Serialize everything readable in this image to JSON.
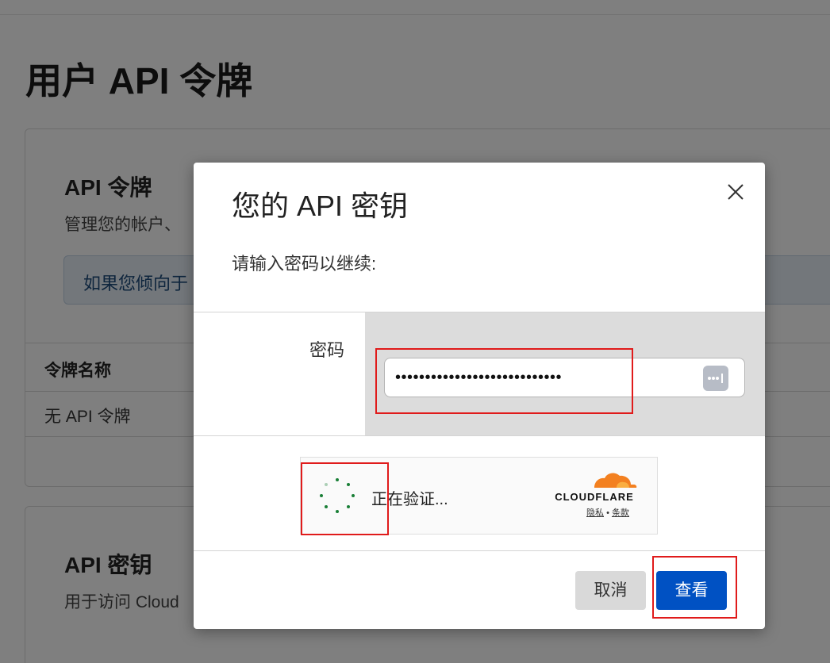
{
  "page": {
    "title": "用户 API 令牌"
  },
  "tokens_card": {
    "heading": "API 令牌",
    "description": "管理您的帐户、",
    "alert_text": "如果您倾向于",
    "table_header": "令牌名称",
    "empty_row": "无 API 令牌"
  },
  "keys_card": {
    "heading": "API 密钥",
    "description": "用于访问 Cloud"
  },
  "modal": {
    "title": "您的 API 密钥",
    "prompt": "请输入密码以继续:",
    "password_label": "密码",
    "password_value": "••••••••••••••••••••••••••••",
    "captcha": {
      "status": "正在验证...",
      "brand": "CLOUDFLARE",
      "privacy_link": "隐私",
      "separator": "•",
      "terms_link": "条款"
    },
    "cancel_label": "取消",
    "view_label": "查看"
  },
  "icons": {
    "close": "close-icon",
    "password_manager": "password-manager-icon",
    "spinner": "loading-spinner-icon",
    "cloudflare_logo": "cloudflare-logo"
  },
  "colors": {
    "primary_button": "#0051c3",
    "cloudflare_orange": "#f38020",
    "annotation_red": "#e01b1b",
    "spinner_green": "#1a7f37"
  }
}
